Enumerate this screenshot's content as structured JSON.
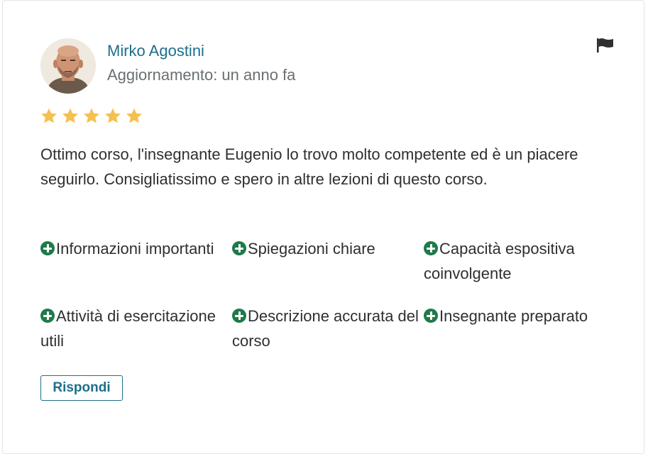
{
  "review": {
    "author": "Mirko Agostini",
    "updated": "Aggiornamento: un anno fa",
    "rating": 5,
    "star_color": "#f4c150",
    "text": "Ottimo corso, l'insegnante Eugenio lo trovo molto competente ed è un piacere seguirlo. Consigliatissimo e spero in altre lezioni di questo corso.",
    "flag_icon": "flag-icon",
    "tags": [
      {
        "label": "Informazioni importanti",
        "icon": "plus-circle-icon"
      },
      {
        "label": "Spiegazioni chiare",
        "icon": "plus-circle-icon"
      },
      {
        "label": "Capacità espositiva coinvolgente",
        "icon": "plus-circle-icon"
      },
      {
        "label": "Attività di esercitazione utili",
        "icon": "plus-circle-icon"
      },
      {
        "label": "Descrizione accurata del corso",
        "icon": "plus-circle-icon"
      },
      {
        "label": "Insegnante preparato",
        "icon": "plus-circle-icon"
      }
    ],
    "reply_label": "Rispondi"
  },
  "colors": {
    "accent": "#1e6f8a",
    "tag_icon": "#1f7a4a",
    "text": "#2d2f31",
    "muted": "#6a6f73"
  }
}
